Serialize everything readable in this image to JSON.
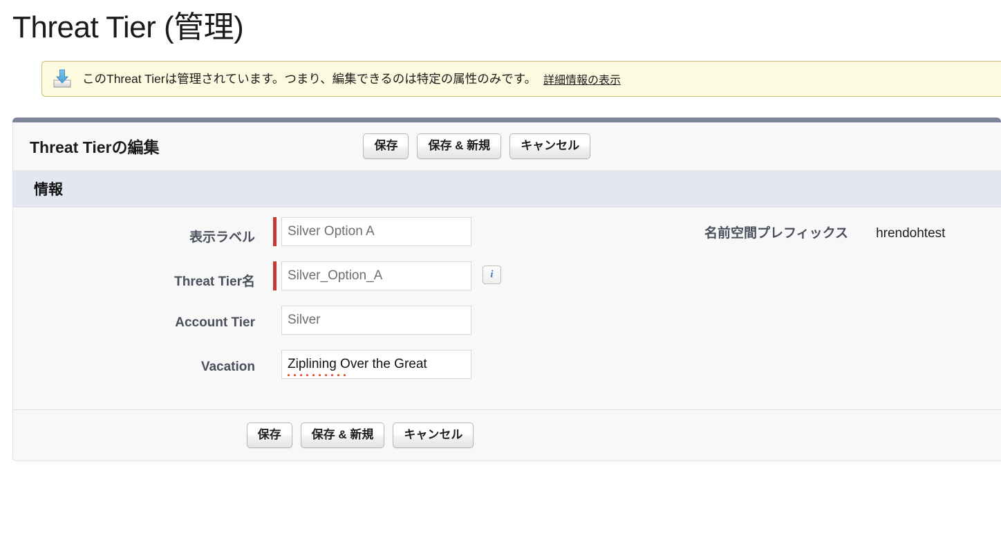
{
  "page": {
    "title": "Threat Tier (管理)"
  },
  "banner": {
    "icon": "install-download-icon",
    "message": "このThreat Tierは管理されています。つまり、編集できるのは特定の属性のみです。",
    "link_label": "詳細情報の表示"
  },
  "panel": {
    "header_title": "Threat Tierの編集",
    "section_title": "情報",
    "buttons": [
      {
        "label": "保存",
        "name": "save-button"
      },
      {
        "label": "保存 & 新規",
        "name": "save-and-new-button"
      },
      {
        "label": "キャンセル",
        "name": "cancel-button"
      }
    ],
    "fields": [
      {
        "label": "表示ラベル",
        "value": "Silver Option A",
        "required": true,
        "has_info": false,
        "spellcheck_error": false
      },
      {
        "label": "Threat Tier名",
        "value": "Silver_Option_A",
        "required": true,
        "has_info": true,
        "info_icon": "info-icon",
        "spellcheck_error": false
      },
      {
        "label": "Account Tier",
        "value": "Silver",
        "required": false,
        "has_info": false,
        "spellcheck_error": false
      },
      {
        "label": "Vacation",
        "value": "Ziplining Over the Great",
        "required": false,
        "has_info": false,
        "spellcheck_error": true
      }
    ],
    "readonly": {
      "label": "名前空間プレフィックス",
      "value": "hrendohtest"
    }
  },
  "colors": {
    "panel_topbar": "#7c8499",
    "section_bar": "#e3e7f0",
    "required_marker": "#c23934",
    "banner_bg": "#fdfbdf",
    "banner_border": "#c9bd78",
    "info_icon_blue": "#3a78c9",
    "spellcheck_red": "#e8503a"
  }
}
